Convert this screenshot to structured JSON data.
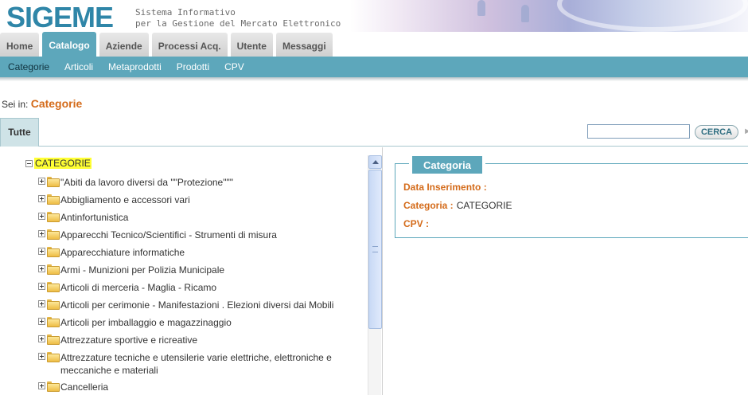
{
  "header": {
    "logo": "SIGEME",
    "subtitle_line1": "Sistema Informativo",
    "subtitle_line2": "per la Gestione del Mercato Elettronico"
  },
  "tabs": [
    {
      "label": "Home",
      "active": false
    },
    {
      "label": "Catalogo",
      "active": true
    },
    {
      "label": "Aziende",
      "active": false
    },
    {
      "label": "Processi Acq.",
      "active": false
    },
    {
      "label": "Utente",
      "active": false
    },
    {
      "label": "Messaggi",
      "active": false
    }
  ],
  "subnav": [
    {
      "label": "Categorie",
      "active": true
    },
    {
      "label": "Articoli",
      "active": false
    },
    {
      "label": "Metaprodotti",
      "active": false
    },
    {
      "label": "Prodotti",
      "active": false
    },
    {
      "label": "CPV",
      "active": false
    }
  ],
  "breadcrumb": {
    "prefix": "Sei in:",
    "current": "Categorie"
  },
  "filter": {
    "tab_label": "Tutte",
    "search_value": "",
    "search_button": "CERCA"
  },
  "tree": {
    "root_label": "CATEGORIE",
    "items": [
      "\"Abiti da lavoro diversi da \"\"Protezione\"\"\"",
      "Abbigliamento e accessori vari",
      "Antinfortunistica",
      "Apparecchi Tecnico/Scientifici - Strumenti di misura",
      "Apparecchiature informatiche",
      "Armi - Munizioni per Polizia Municipale",
      "Articoli di merceria - Maglia - Ricamo",
      "Articoli per cerimonie - Manifestazioni . Elezioni diversi dai Mobili",
      "Articoli per imballaggio e magazzinaggio",
      "Attrezzature sportive e ricreative",
      "Attrezzature tecniche e utensilerie varie elettriche, elettroniche e meccaniche e materiali",
      "Cancelleria"
    ]
  },
  "details": {
    "title": "Categoria",
    "fields": [
      {
        "label": "Data Inserimento :",
        "value": ""
      },
      {
        "label": "Categoria :",
        "value": "CATEGORIE"
      },
      {
        "label": "CPV :",
        "value": ""
      }
    ]
  },
  "colors": {
    "accent": "#5da7bb",
    "label_orange": "#d46b1a",
    "highlight": "#ffff33",
    "logo_blue": "#2f86a8"
  }
}
